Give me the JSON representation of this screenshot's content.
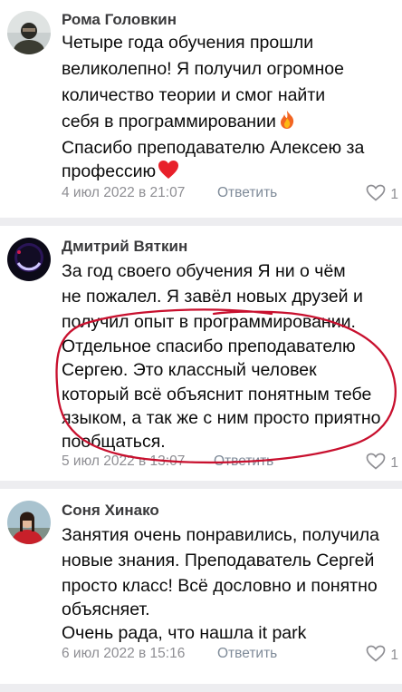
{
  "comments": [
    {
      "author": "Рома Головкин",
      "lines": [
        "Четыре года обучения прошли",
        "великолепно! Я получил огромное",
        "количество теории и смог найти",
        "себя в программировании",
        "Спасибо преподавателю Алексею за",
        "профессию"
      ],
      "date": "4 июл 2022 в 21:07",
      "reply_label": "Ответить",
      "likes": "1"
    },
    {
      "author": "Дмитрий Вяткин",
      "lines": [
        "За год своего обучения Я ни о чём",
        "не пожалел. Я завёл новых друзей и",
        "получил опыт в программировании.",
        "Отдельное спасибо преподавателю",
        "Сергею. Это классный человек",
        "который всё объяснит понятным тебе",
        "языком, а так же с ним просто приятно",
        "пообщаться."
      ],
      "date": "5 июл 2022 в 13:07",
      "reply_label": "Ответить",
      "likes": "1"
    },
    {
      "author": "Соня Хинако",
      "lines": [
        "Занятия очень понравились, получила",
        "новые знания. Преподаватель Сергей",
        "просто класс! Всё дословно и понятно",
        "объясняет.",
        "Очень рада, что нашла it park"
      ],
      "date": "6 июл 2022 в 15:16",
      "reply_label": "Ответить",
      "likes": "1"
    }
  ],
  "colors": {
    "text": "#0b0b0b",
    "meta": "#8e8e93",
    "reply": "#7e8a98",
    "divider": "#ededf0",
    "highlight_circle": "#c8102e"
  },
  "icons": {
    "like": "heart-outline-icon",
    "fire": "fire-emoji-icon",
    "heart_emoji": "red-heart-emoji-icon"
  }
}
